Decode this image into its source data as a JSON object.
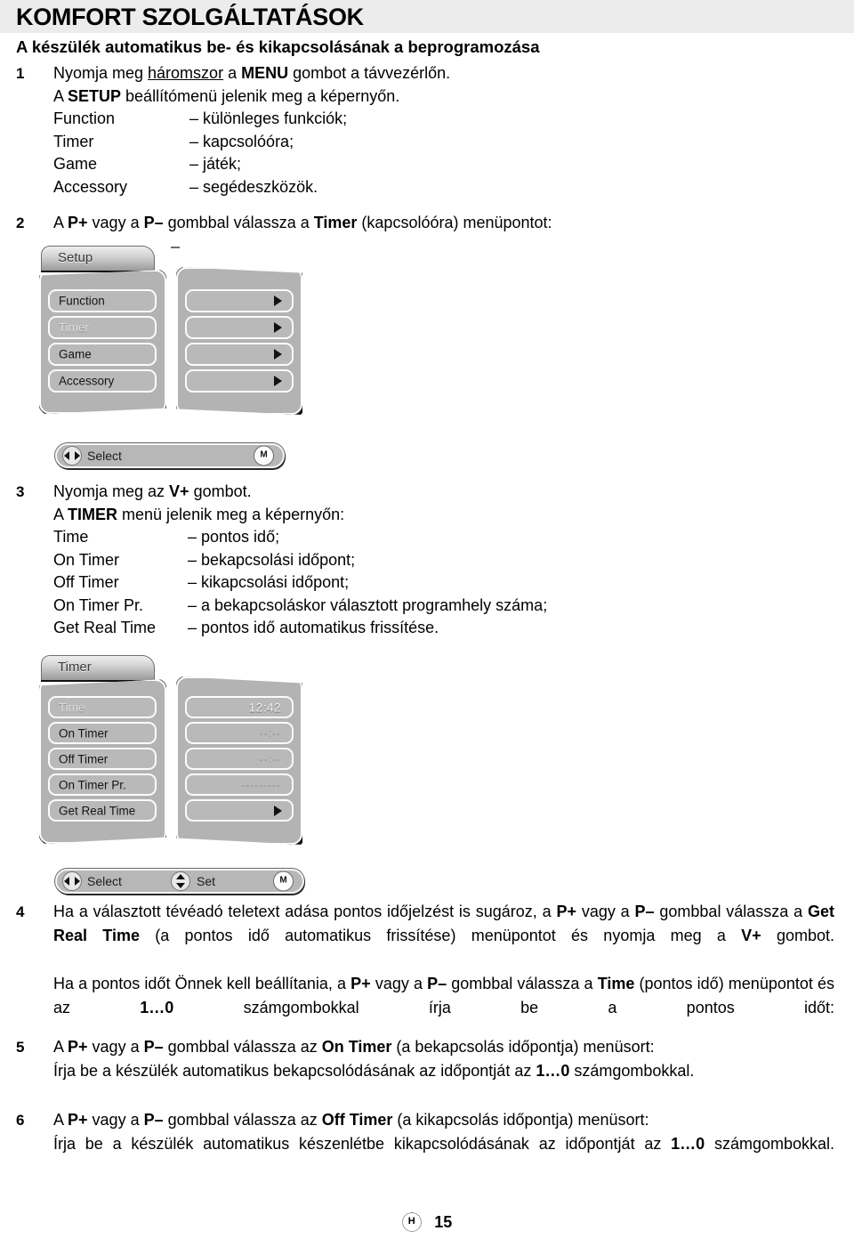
{
  "document": {
    "title": "KOMFORT SZOLGÁLTATÁSOK",
    "subtitle": "A készülék automatikus be- és kikapcsolásának a beprogramozása",
    "page_number": "15",
    "language_mark": "H"
  },
  "step1": {
    "number": "1",
    "line1_a": "Nyomja meg ",
    "line1_underlined": "háromszor",
    "line1_b": " a ",
    "line1_bold": "MENU",
    "line1_c": " gombot a távvezérlőn.",
    "line2_a": "A ",
    "line2_bold": "SETUP",
    "line2_b": " beállítómenü jelenik meg a képernyőn.",
    "definitions": [
      {
        "term": "Function",
        "def": "– különleges funkciók;"
      },
      {
        "term": "Timer",
        "def": "– kapcsolóóra;"
      },
      {
        "term": "Game",
        "def": "– játék;"
      },
      {
        "term": "Accessory",
        "def": "– segédeszközök."
      }
    ]
  },
  "step2": {
    "number": "2",
    "text_a": "A ",
    "bold_pplus": "P+",
    "text_b": " vagy a ",
    "bold_pminus": "P–",
    "text_c": " gombbal válassza a ",
    "bold_timer": "Timer",
    "text_d": " (kapcsolóóra) menüpontot:"
  },
  "setup_osd": {
    "tab_label": "Setup",
    "items": [
      {
        "label": "Function",
        "selected": false,
        "has_arrow": true
      },
      {
        "label": "Timer",
        "selected": true,
        "has_arrow": true
      },
      {
        "label": "Game",
        "selected": false,
        "has_arrow": true
      },
      {
        "label": "Accessory",
        "selected": false,
        "has_arrow": true
      }
    ],
    "hint_select": "Select",
    "hint_menu_btn": "M"
  },
  "step3": {
    "number": "3",
    "line1_a": "Nyomja meg az ",
    "line1_bold": "V+",
    "line1_b": " gombot.",
    "line2_a": "A ",
    "line2_bold": "TIMER",
    "line2_b": " menü jelenik meg a képernyőn:",
    "definitions": [
      {
        "term": "Time",
        "def": "– pontos idő;"
      },
      {
        "term": "On Timer",
        "def": "– bekapcsolási időpont;"
      },
      {
        "term": "Off Timer",
        "def": "– kikapcsolási időpont;"
      },
      {
        "term": "On Timer Pr.",
        "def": "– a bekapcsoláskor választott programhely száma;"
      },
      {
        "term": "Get Real Time",
        "def": "– pontos idő automatikus frissítése."
      }
    ]
  },
  "timer_osd": {
    "tab_label": "Timer",
    "items": [
      {
        "label": "Time",
        "value": "12:42",
        "selected": true,
        "has_arrow": false,
        "dim": false
      },
      {
        "label": "On Timer",
        "value": "--:--",
        "selected": false,
        "has_arrow": false,
        "dim": true
      },
      {
        "label": "Off Timer",
        "value": "--:--",
        "selected": false,
        "has_arrow": false,
        "dim": true
      },
      {
        "label": "On Timer Pr.",
        "value": "---------",
        "selected": false,
        "has_arrow": false,
        "dim": true
      },
      {
        "label": "Get Real Time",
        "value": "",
        "selected": false,
        "has_arrow": true,
        "dim": false
      }
    ],
    "hint_select": "Select",
    "hint_set": "Set",
    "hint_menu_btn": "M"
  },
  "step4": {
    "number": "4",
    "p1_a": "Ha a választott tévéadó teletext adása pontos időjelzést is sugároz, a ",
    "p1_b1": "P+",
    "p1_b": " vagy a ",
    "p1_b2": "P–",
    "p1_c": " gombbal válassza a ",
    "p1_b3": "Get Real Time",
    "p1_d": " (a pontos idő automatikus frissítése) menüpontot és nyomja meg a ",
    "p1_b4": "V+",
    "p1_e": " gombot.",
    "p2_a": "Ha a pontos időt Önnek kell beállítania, a ",
    "p2_b1": "P+",
    "p2_b": " vagy a ",
    "p2_b2": "P–",
    "p2_c": " gombbal válassza a ",
    "p2_b3": "Time",
    "p2_d": " (pontos idő) menüpontot és az ",
    "p2_b4": "1…0",
    "p2_e": " számgombokkal írja be a pontos időt:"
  },
  "step5": {
    "number": "5",
    "l1_a": "A ",
    "l1_b1": "P+",
    "l1_b": " vagy a ",
    "l1_b2": "P–",
    "l1_c": " gombbal válassza az ",
    "l1_b3": "On Timer",
    "l1_d": " (a bekapcsolás időpontja) menüsort:",
    "l2_a": "Írja be a készülék automatikus bekapcsolódásának az időpontját az ",
    "l2_b1": "1…0",
    "l2_b": " számgombokkal."
  },
  "step6": {
    "number": "6",
    "l1_a": "A ",
    "l1_b1": "P+",
    "l1_b": " vagy a ",
    "l1_b2": "P–",
    "l1_c": " gombbal válassza az ",
    "l1_b3": "Off Timer",
    "l1_d": " (a kikapcsolás időpontja) menüsort:",
    "l2_a": "Írja be a készülék automatikus készenlétbe kikapcsolódásának az időpontját az ",
    "l2_b1": "1…0",
    "l2_b": " számgombokkal."
  },
  "colors": {
    "title_band": "#ececec",
    "osd_panel": "#b3b3b3",
    "osd_item": "#b9b9b9",
    "text": "#000000"
  }
}
